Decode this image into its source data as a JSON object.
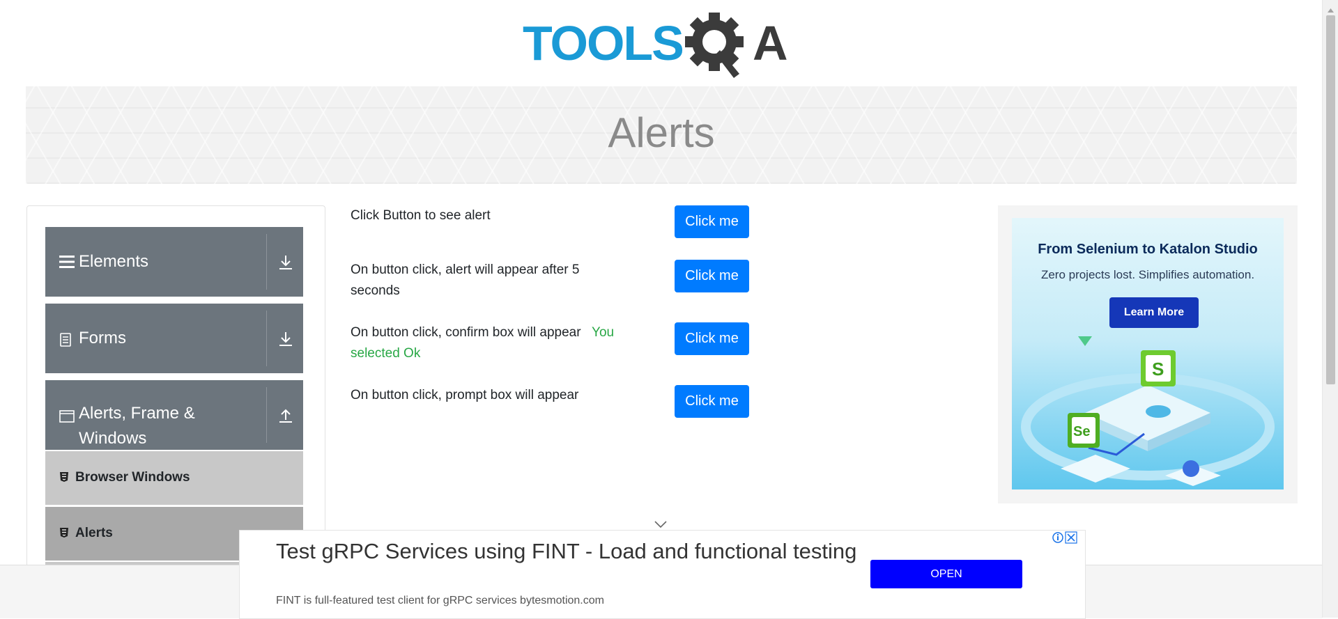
{
  "header": {
    "logo_text_left": "TOOLS",
    "logo_text_right": "A",
    "logo_color_blue": "#1a9ad6",
    "logo_color_dark": "#3b3b3b"
  },
  "banner": {
    "title": "Alerts"
  },
  "sidebar": {
    "groups": [
      {
        "label": "Elements",
        "icon": "hamburger-icon",
        "toggle": "download-icon"
      },
      {
        "label": "Forms",
        "icon": "document-icon",
        "toggle": "download-icon"
      },
      {
        "label": "Alerts, Frame & Windows",
        "icon": "window-icon",
        "toggle": "upload-icon"
      }
    ],
    "items": [
      {
        "label": "Browser Windows",
        "icon": "html5-icon",
        "active": false
      },
      {
        "label": "Alerts",
        "icon": "html5-icon",
        "active": true
      }
    ]
  },
  "main": {
    "rows": [
      {
        "text": "Click Button to see alert",
        "button": "Click me"
      },
      {
        "text": "On button click, alert will appear after 5 seconds",
        "button": "Click me"
      },
      {
        "text": "On button click, confirm box will appear",
        "result": "You selected Ok",
        "button": "Click me"
      },
      {
        "text": "On button click, prompt box will appear",
        "button": "Click me"
      }
    ]
  },
  "side_ad": {
    "title": "From Selenium to Katalon Studio",
    "subtitle": "Zero projects lost. Simplifies automation.",
    "button": "Learn More",
    "badge_s": "S",
    "badge_se": "Se"
  },
  "bottom_ad": {
    "title": "Test gRPC Services using FINT - Load and functional testing",
    "subtitle": "FINT is full-featured test client for gRPC services bytesmotion.com",
    "button": "OPEN"
  },
  "colors": {
    "primary": "#007bff",
    "sidebar_group": "#6c757d",
    "success": "#28a745",
    "ad_button": "#0000ff"
  }
}
